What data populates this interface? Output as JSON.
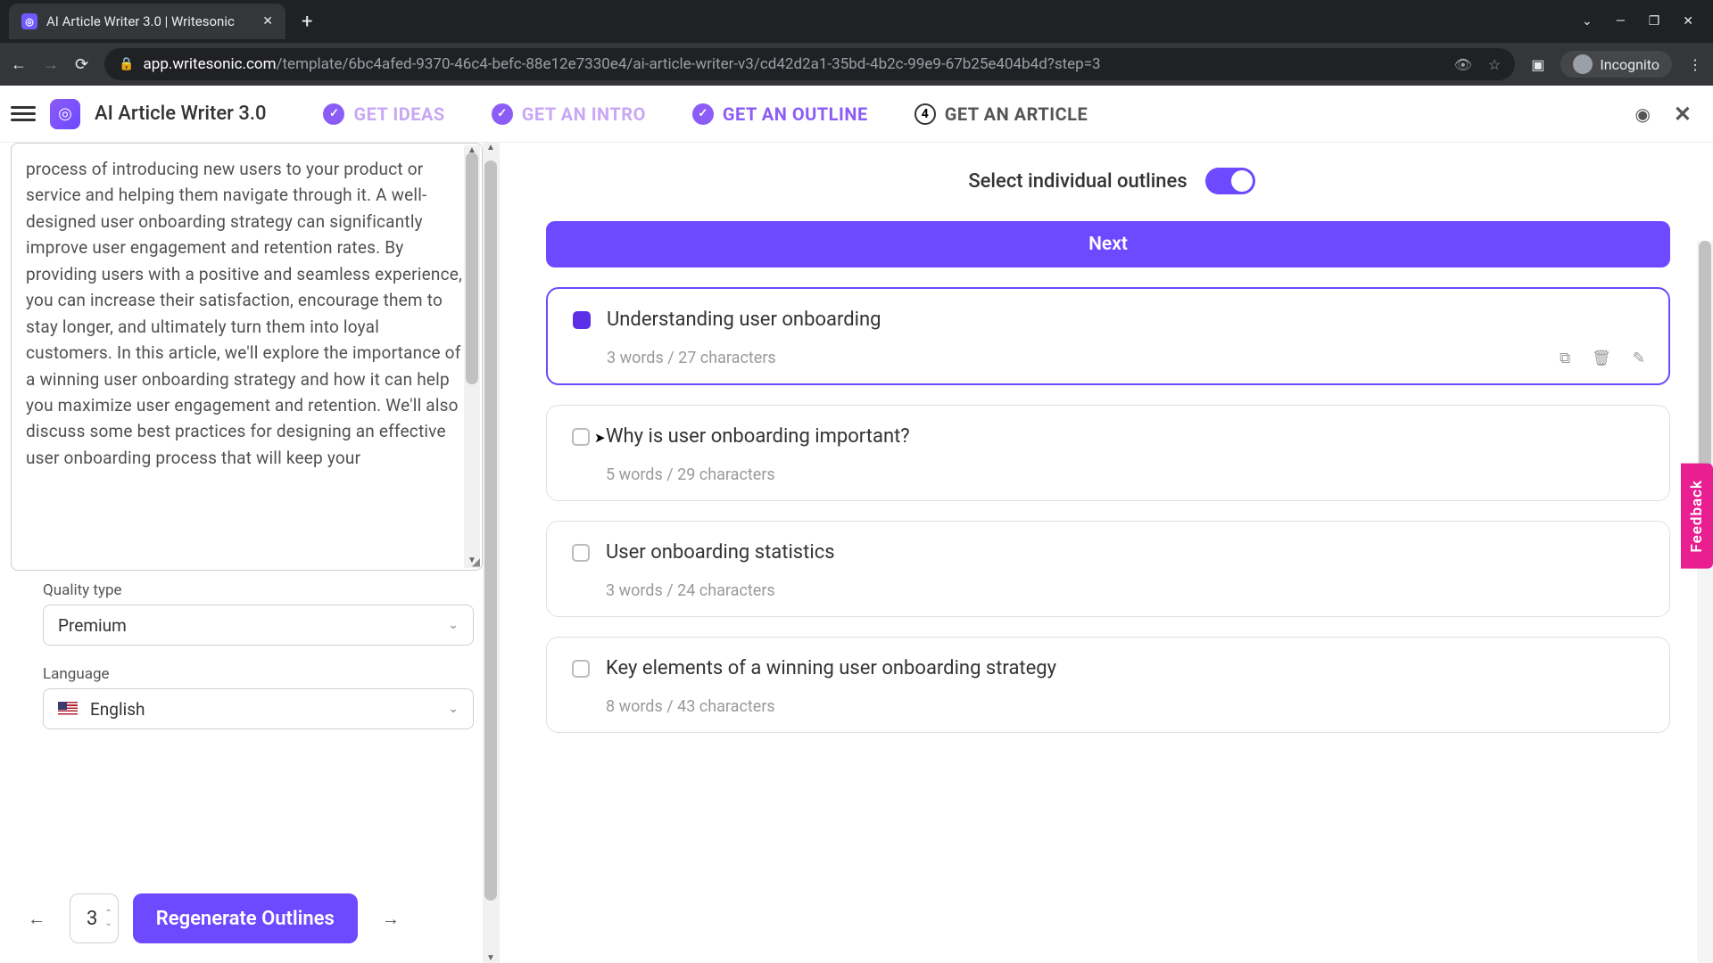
{
  "browser": {
    "tab_title": "AI Article Writer 3.0 | Writesonic",
    "url_domain": "app.writesonic.com",
    "url_path": "/template/6bc4afed-9370-46c4-befc-88e12e7330e4/ai-article-writer-v3/cd42d2a1-35bd-4b2c-99e9-67b25e404b4d?step=3",
    "incognito": "Incognito"
  },
  "header": {
    "app_title": "AI Article Writer 3.0",
    "steps": {
      "s1": "GET IDEAS",
      "s2": "GET AN INTRO",
      "s3": "GET AN OUTLINE",
      "s4_num": "4",
      "s4": "GET AN ARTICLE"
    }
  },
  "sidebar": {
    "intro_text": "process of introducing new users to your product or service and helping them navigate through it. A well-designed user onboarding strategy can significantly improve user engagement and retention rates. By providing users with a positive and seamless experience, you can increase their satisfaction, encourage them to stay longer, and ultimately turn them into loyal customers. In this article, we'll explore the importance of a winning user onboarding strategy and how it can help you maximize user engagement and retention. We'll also discuss some best practices for designing an effective user onboarding process that will keep your",
    "quality_label": "Quality type",
    "quality_value": "Premium",
    "language_label": "Language",
    "language_value": "English",
    "count_value": "3",
    "regen_button": "Regenerate Outlines"
  },
  "main": {
    "toggle_label": "Select individual outlines",
    "next_button": "Next",
    "outlines": [
      {
        "title": "Understanding user onboarding",
        "stats": "3 words / 27 characters",
        "checked": true
      },
      {
        "title": "Why is user onboarding important?",
        "stats": "5 words / 29 characters",
        "checked": false
      },
      {
        "title": "User onboarding statistics",
        "stats": "3 words / 24 characters",
        "checked": false
      },
      {
        "title": "Key elements of a winning user onboarding strategy",
        "stats": "8 words / 43 characters",
        "checked": false
      }
    ]
  },
  "feedback": "Feedback"
}
